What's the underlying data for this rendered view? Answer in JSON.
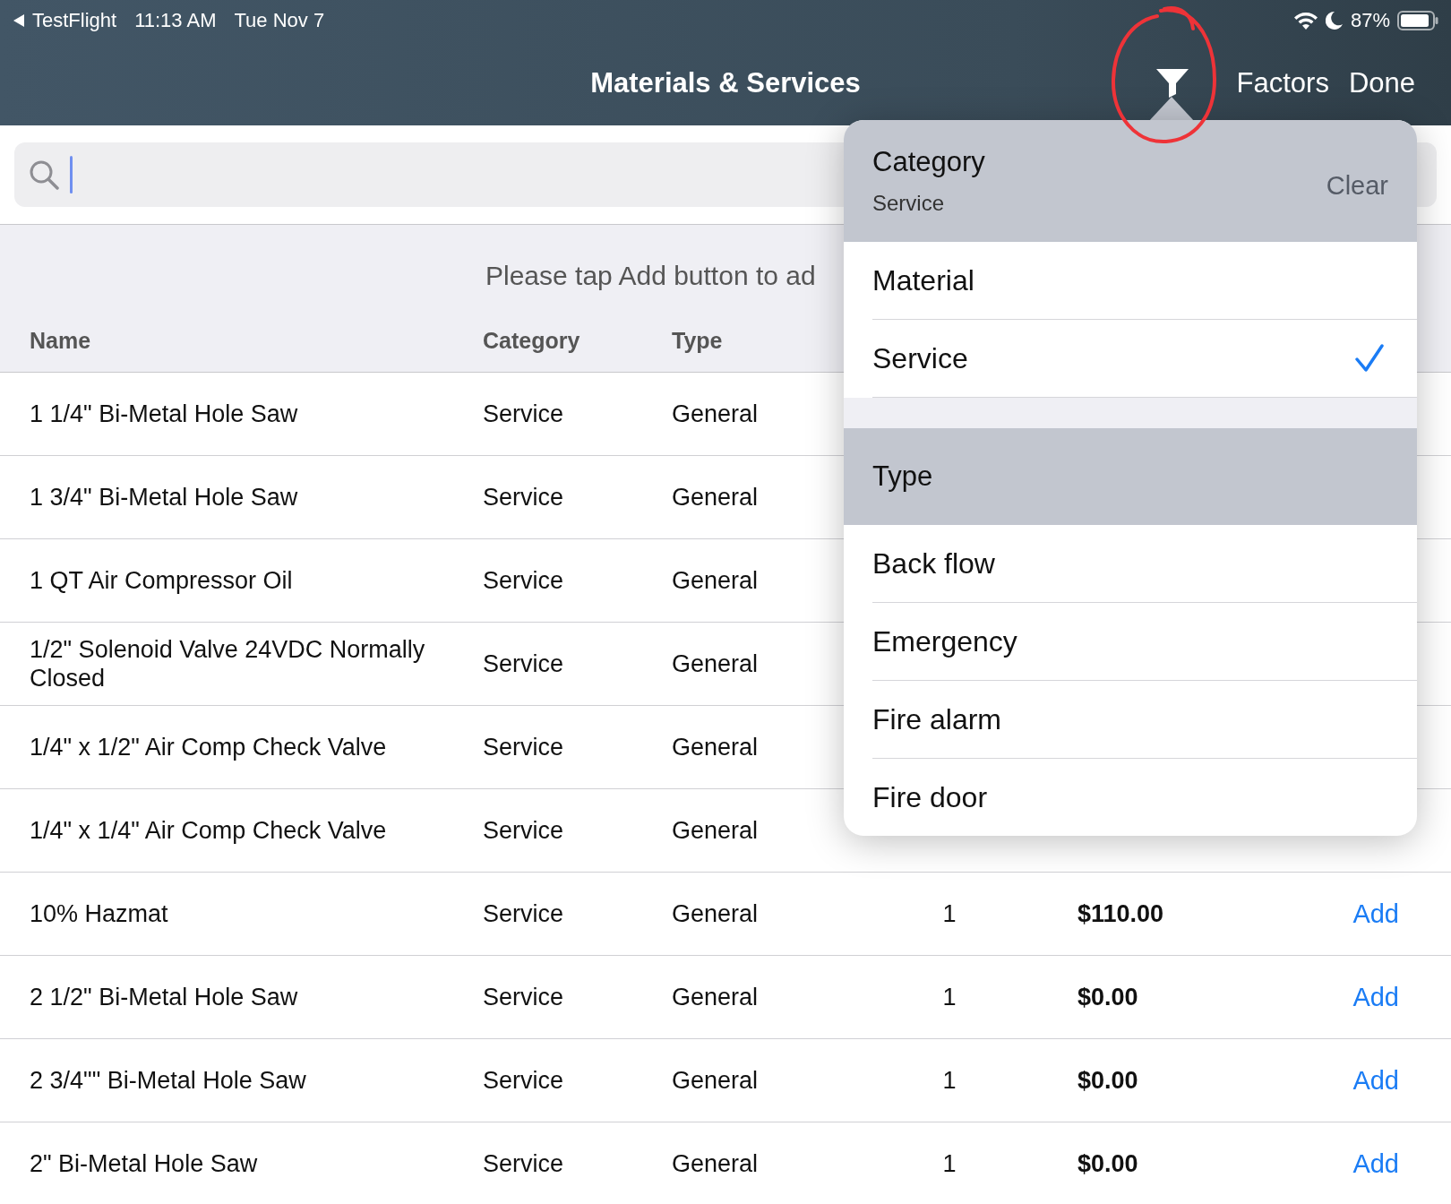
{
  "status_bar": {
    "back_label": "TestFlight",
    "time": "11:13 AM",
    "date": "Tue Nov 7",
    "battery": "87%"
  },
  "nav": {
    "title": "Materials & Services",
    "buttons": [
      "Factors",
      "Done"
    ]
  },
  "search": {
    "focused": true
  },
  "table": {
    "message": "Please tap Add button to ad",
    "columns": [
      "Name",
      "Category",
      "Type"
    ],
    "rows": [
      {
        "name": "1 1/4\" Bi-Metal Hole Saw",
        "category": "Service",
        "type": "General"
      },
      {
        "name": "1 3/4\" Bi-Metal Hole Saw",
        "category": "Service",
        "type": "General"
      },
      {
        "name": "1 QT Air Compressor Oil",
        "category": "Service",
        "type": "General"
      },
      {
        "name": "1/2\" Solenoid Valve 24VDC Normally Closed",
        "category": "Service",
        "type": "General"
      },
      {
        "name": "1/4\" x 1/2\" Air Comp Check Valve",
        "category": "Service",
        "type": "General"
      },
      {
        "name": "1/4\" x 1/4\" Air Comp Check Valve",
        "category": "Service",
        "type": "General"
      },
      {
        "name": "10% Hazmat",
        "category": "Service",
        "type": "General",
        "qty": "1",
        "price": "$110.00",
        "action": "Add"
      },
      {
        "name": "2 1/2\" Bi-Metal Hole Saw",
        "category": "Service",
        "type": "General",
        "qty": "1",
        "price": "$0.00",
        "action": "Add"
      },
      {
        "name": "2 3/4\"\" Bi-Metal Hole Saw",
        "category": "Service",
        "type": "General",
        "qty": "1",
        "price": "$0.00",
        "action": "Add"
      },
      {
        "name": "2\" Bi-Metal Hole Saw",
        "category": "Service",
        "type": "General",
        "qty": "1",
        "price": "$0.00",
        "action": "Add"
      }
    ]
  },
  "filter_popover": {
    "sections": [
      {
        "title": "Category",
        "subtitle": "Service",
        "clear": "Clear",
        "options": [
          {
            "label": "Material",
            "selected": false
          },
          {
            "label": "Service",
            "selected": true
          }
        ]
      },
      {
        "title": "Type",
        "options": [
          {
            "label": "Back flow",
            "selected": false
          },
          {
            "label": "Emergency",
            "selected": false
          },
          {
            "label": "Fire alarm",
            "selected": false
          },
          {
            "label": "Fire door",
            "selected": false
          }
        ]
      }
    ]
  }
}
